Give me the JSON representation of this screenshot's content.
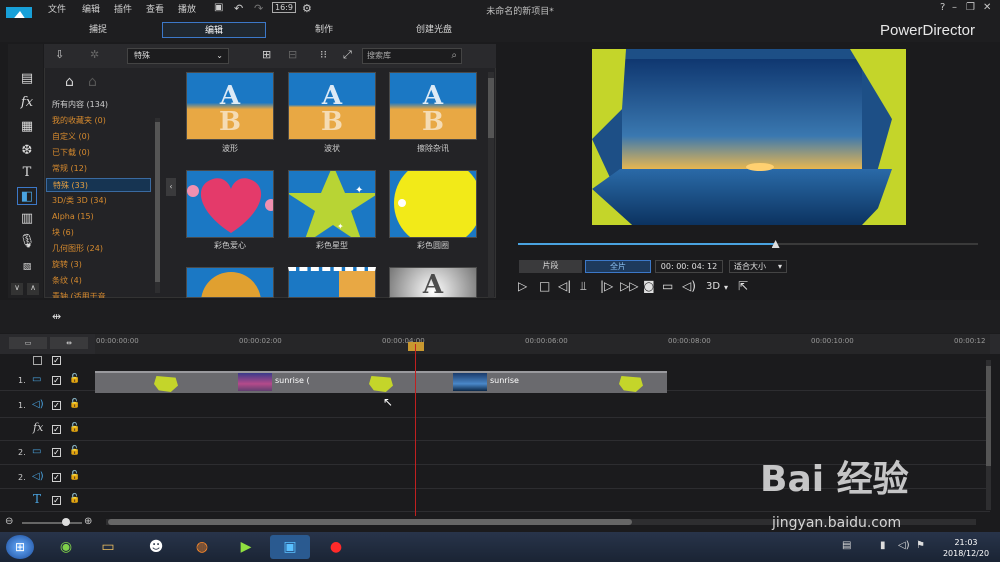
{
  "menu": [
    "文件",
    "编辑",
    "插件",
    "查看",
    "播放"
  ],
  "window_title": "未命名的新项目*",
  "brand": "PowerDirector",
  "modes": {
    "capture": "捕捉",
    "edit": "编辑",
    "produce": "制作",
    "disc": "创建光盘"
  },
  "library": {
    "category_value": "特殊",
    "search_placeholder": "搜索库",
    "categories": [
      {
        "label": "所有内容 (134)"
      },
      {
        "label": "我的收藏夹  (0)"
      },
      {
        "label": "自定义  (0)"
      },
      {
        "label": "已下载  (0)"
      },
      {
        "label": "常规  (12)"
      },
      {
        "label": "特殊  (33)"
      },
      {
        "label": "3D/类 3D  (34)"
      },
      {
        "label": "Alpha  (15)"
      },
      {
        "label": "块  (6)"
      },
      {
        "label": "几何图形  (24)"
      },
      {
        "label": "旋转  (3)"
      },
      {
        "label": "条纹  (4)"
      },
      {
        "label": "青轴 (适用于音"
      }
    ],
    "items": [
      {
        "label": "波形"
      },
      {
        "label": "波状"
      },
      {
        "label": "擦除杂讯"
      },
      {
        "label": "彩色爱心"
      },
      {
        "label": "彩色星型"
      },
      {
        "label": "彩色圆圈"
      }
    ]
  },
  "preview": {
    "clip_tab": "片段",
    "movie_tab": "全片",
    "timecode": "00: 00: 04: 12",
    "fit": "适合大小",
    "three_d": "3D",
    "seek_position": 0.56
  },
  "timeline": {
    "ticks": [
      "00:00:00:00",
      "00:00:02:00",
      "00:00:04:00",
      "00:00:06:00",
      "00:00:08:00",
      "00:00:10:00",
      "00:00:12"
    ],
    "tracks": [
      {
        "label": "1."
      },
      {
        "label": "1."
      },
      {
        "label": "fx"
      },
      {
        "label": "2."
      },
      {
        "label": "2."
      },
      {
        "label": "T"
      }
    ],
    "clip_names": [
      "sunrise (",
      "sunrise"
    ]
  },
  "taskbar": {
    "time": "21:03",
    "date": "2018/12/20"
  },
  "watermark": {
    "text": "Bai 经验",
    "sub": "jingyan.baidu.com"
  },
  "colors": {
    "accent": "#3c78c8",
    "transition_green": "#c4d52a",
    "playhead": "#c02020"
  }
}
